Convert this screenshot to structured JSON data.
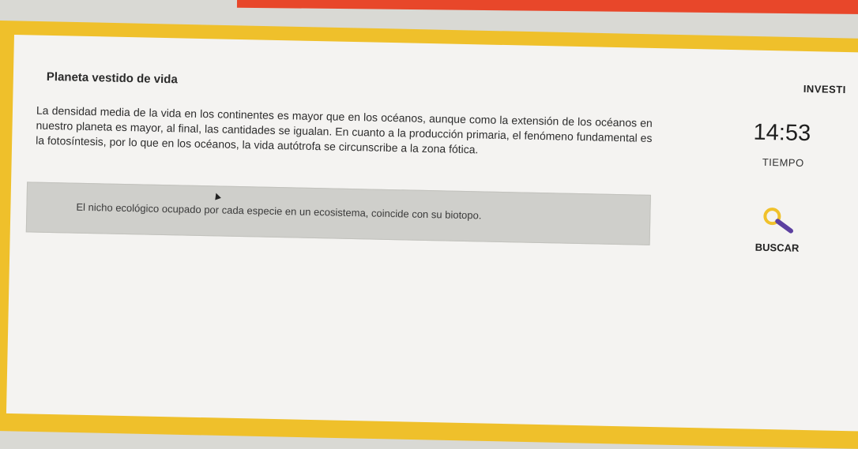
{
  "header": {
    "title": "Planeta vestido de vida",
    "tab_label": "INVESTI"
  },
  "question": {
    "text": "La densidad media de la vida en los continentes es mayor que en los océanos, aunque como la extensión de los océanos en nuestro planeta es mayor, al final, las cantidades se igualan. En cuanto a la producción primaria, el fenómeno fundamental es la fotosíntesis, por lo que en los océanos, la vida autótrofa se circunscribe a la zona fótica."
  },
  "answer": {
    "text": "El nicho ecológico ocupado por cada especie en un ecosistema, coincide con su biotopo."
  },
  "timer": {
    "value": "14:53",
    "label": "TIEMPO"
  },
  "search": {
    "label": "BUSCAR",
    "icon": "magnifier-icon"
  },
  "colors": {
    "accent_top": "#e8472a",
    "frame": "#efc02b",
    "card": "#f4f3f1",
    "answer_box": "#cfcfcb",
    "icon_ring": "#f0c12b",
    "icon_handle": "#5b3fa0"
  }
}
